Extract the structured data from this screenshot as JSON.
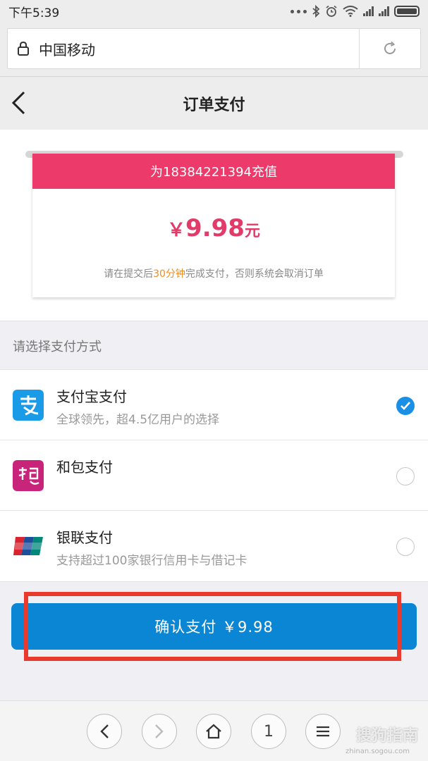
{
  "status_bar": {
    "time": "下午5:39"
  },
  "browser": {
    "url_text": "中国移动"
  },
  "header": {
    "title": "订单支付"
  },
  "order": {
    "recharge_label": "为18384221394充值",
    "currency": "￥",
    "amount": "9.98",
    "unit": "元",
    "notice_prefix": "请在提交后",
    "notice_highlight": "30分钟",
    "notice_suffix": "完成支付，否则系统会取消订单"
  },
  "payment": {
    "section_label": "请选择支付方式",
    "methods": [
      {
        "name": "支付宝支付",
        "desc": "全球领先，超4.5亿用户的选择",
        "icon": "alipay-icon",
        "selected": true
      },
      {
        "name": "和包支付",
        "desc": "",
        "icon": "hebao-icon",
        "selected": false
      },
      {
        "name": "银联支付",
        "desc": "支持超过100家银行信用卡与借记卡",
        "icon": "unionpay-icon",
        "selected": false
      }
    ]
  },
  "confirm": {
    "label": "确认支付 ￥9.98"
  },
  "toolbar": {
    "tab_count": "1"
  },
  "watermark": {
    "text": "搜狗指南",
    "sub": "zhinan.sogou.com"
  },
  "colors": {
    "brand_pink": "#ec3a6a",
    "amount_pink": "#e23b6a",
    "confirm_blue": "#0b86d4",
    "highlight_red": "#ea3a2e",
    "notice_orange": "#f28c1c"
  }
}
